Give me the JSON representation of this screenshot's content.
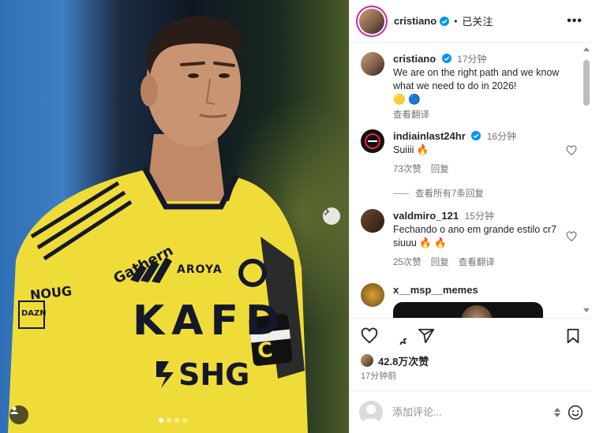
{
  "post": {
    "username": "cristiano",
    "follow_status": "已关注",
    "more_label": "•••",
    "photo_dots": 4,
    "photo_active_dot": 0,
    "jersey": {
      "brand_left": "Gathern",
      "sponsor_top": "AROYA",
      "sponsor_main": "KAFD",
      "sponsor_bottom": "SHG",
      "sleeve_top": "NOUG",
      "sleeve_bottom": "DAZN",
      "armband": "C"
    }
  },
  "comments": [
    {
      "username": "cristiano",
      "verified": true,
      "time": "17分钟",
      "text": "We are on the right path and we know what we need to do in 2026!",
      "emoji_line": "🟡 🔵",
      "translate": "查看翻译"
    },
    {
      "username": "indiainlast24hr",
      "verified": true,
      "time": "16分钟",
      "text": "Suiiii 🔥",
      "likes": "73次赞",
      "reply": "回复"
    },
    {
      "view_all": "查看所有7条回复"
    },
    {
      "username": "valdmiro_121",
      "verified": false,
      "time": "15分钟",
      "text": "Fechando o ano em grande estilo cr7 siuuu 🔥 🔥",
      "likes": "25次赞",
      "reply": "回复",
      "translate": "查看翻译"
    },
    {
      "username": "x__msp__memes",
      "verified": false
    }
  ],
  "actions": {
    "likes_count": "42.8万次赞",
    "posted_time": "17分钟前"
  },
  "add_comment": {
    "placeholder": "添加评论..."
  },
  "colors": {
    "verified_blue": "#0095f6",
    "jersey_yellow": "#f2e23a",
    "jersey_navy": "#14182b",
    "muted_text": "#737373"
  }
}
